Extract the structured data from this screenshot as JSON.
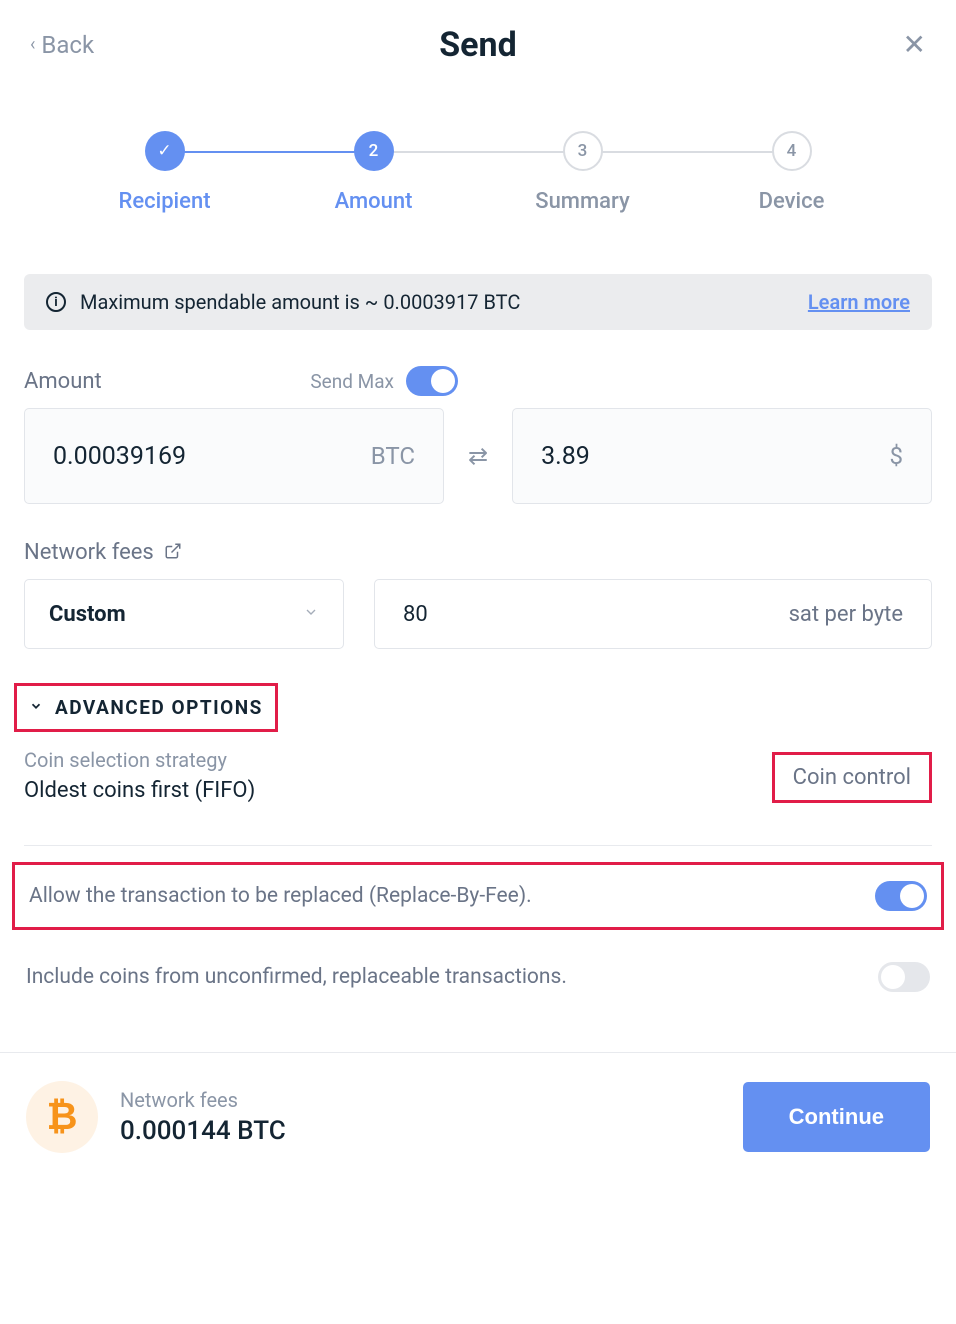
{
  "header": {
    "back_label": "Back",
    "title": "Send"
  },
  "stepper": {
    "steps": [
      {
        "label": "Recipient",
        "indicator": "✓"
      },
      {
        "label": "Amount",
        "indicator": "2"
      },
      {
        "label": "Summary",
        "indicator": "3"
      },
      {
        "label": "Device",
        "indicator": "4"
      }
    ]
  },
  "banner": {
    "text": "Maximum spendable amount is ~ 0.0003917 BTC",
    "link": "Learn more"
  },
  "amount": {
    "label": "Amount",
    "send_max_label": "Send Max",
    "crypto_value": "0.00039169",
    "crypto_unit": "BTC",
    "fiat_value": "3.89",
    "fiat_unit": "$"
  },
  "fees": {
    "label": "Network fees",
    "dropdown_selected": "Custom",
    "fee_value": "80",
    "fee_unit": "sat per byte"
  },
  "advanced": {
    "title": "ADVANCED OPTIONS",
    "coin_strategy_label": "Coin selection strategy",
    "coin_strategy_value": "Oldest coins first (FIFO)",
    "coin_control_btn": "Coin control",
    "rbf_label": "Allow the transaction to be replaced (Replace-By-Fee).",
    "unconfirmed_label": "Include coins from unconfirmed, replaceable transactions."
  },
  "footer": {
    "fees_label": "Network fees",
    "fees_value": "0.000144 BTC",
    "continue": "Continue"
  }
}
